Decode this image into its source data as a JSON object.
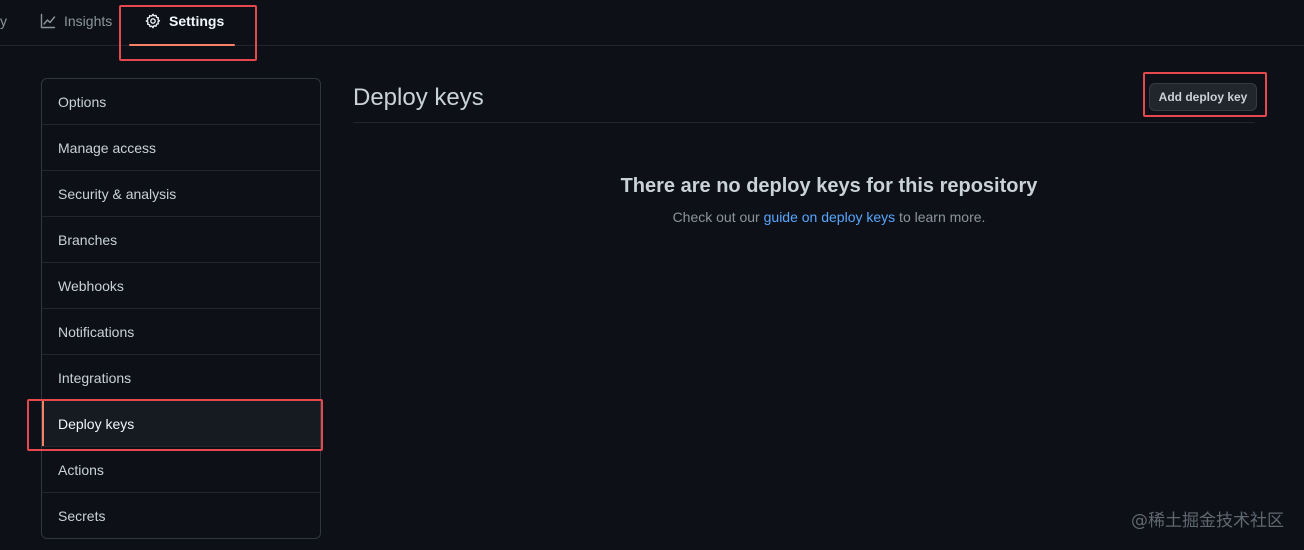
{
  "topnav": {
    "cut_tab_label": "y",
    "insights_label": "Insights",
    "settings_label": "Settings"
  },
  "sidebar": {
    "items": [
      {
        "label": "Options"
      },
      {
        "label": "Manage access"
      },
      {
        "label": "Security & analysis"
      },
      {
        "label": "Branches"
      },
      {
        "label": "Webhooks"
      },
      {
        "label": "Notifications"
      },
      {
        "label": "Integrations"
      },
      {
        "label": "Deploy keys",
        "selected": true
      },
      {
        "label": "Actions"
      },
      {
        "label": "Secrets"
      }
    ]
  },
  "main": {
    "title": "Deploy keys",
    "add_button_label": "Add deploy key",
    "blankslate": {
      "heading": "There are no deploy keys for this repository",
      "text_before": "Check out our ",
      "link_text": "guide on deploy keys",
      "text_after": " to learn more."
    }
  },
  "watermark": "@稀土掘金技术社区",
  "colors": {
    "background": "#0d1117",
    "accent_underline": "#f78166",
    "link": "#58a6ff",
    "highlight_box": "#e5484d"
  }
}
